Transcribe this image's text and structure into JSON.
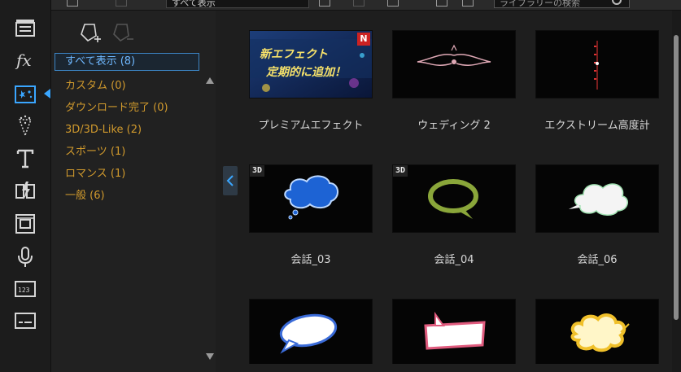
{
  "toolbar": {
    "filter_select_value": "すべて表示",
    "search_placeholder": "ライブラリーの検索"
  },
  "sidebar": {
    "icons": [
      "clapperboard-icon",
      "fx-icon",
      "particle-icon",
      "spray-icon",
      "title-text-icon",
      "transition-icon",
      "pip-designer-icon",
      "microphone-icon",
      "chapter-icon",
      "subtitle-icon"
    ],
    "active_index": 2
  },
  "categories": {
    "items": [
      {
        "label": "すべて表示 (8)",
        "selected": true
      },
      {
        "label": "カスタム (0)",
        "selected": false
      },
      {
        "label": "ダウンロード完了 (0)",
        "selected": false
      },
      {
        "label": "3D/3D-Like (2)",
        "selected": false
      },
      {
        "label": "スポーツ (1)",
        "selected": false
      },
      {
        "label": "ロマンス (1)",
        "selected": false
      },
      {
        "label": "一般 (6)",
        "selected": false
      }
    ]
  },
  "effects": [
    {
      "label": "プレミアムエフェクト",
      "thumb": "premium",
      "banner_line1": "新エフェクト",
      "banner_line2": "定期的に追加！",
      "badge": "N"
    },
    {
      "label": "ウェディング 2",
      "thumb": "wedding"
    },
    {
      "label": "エクストリーム高度計",
      "thumb": "altimeter"
    },
    {
      "label": "会話_03",
      "thumb": "bubble-blue",
      "badge": "3D"
    },
    {
      "label": "会話_04",
      "thumb": "bubble-green",
      "badge": "3D"
    },
    {
      "label": "会話_06",
      "thumb": "cloud-white"
    },
    {
      "label": "",
      "thumb": "oval-white"
    },
    {
      "label": "",
      "thumb": "rect-pink"
    },
    {
      "label": "",
      "thumb": "burst-yellow"
    }
  ],
  "colors": {
    "accent": "#3aa6ff",
    "category_text": "#d19a2d",
    "selected_text": "#6fb8ff"
  }
}
